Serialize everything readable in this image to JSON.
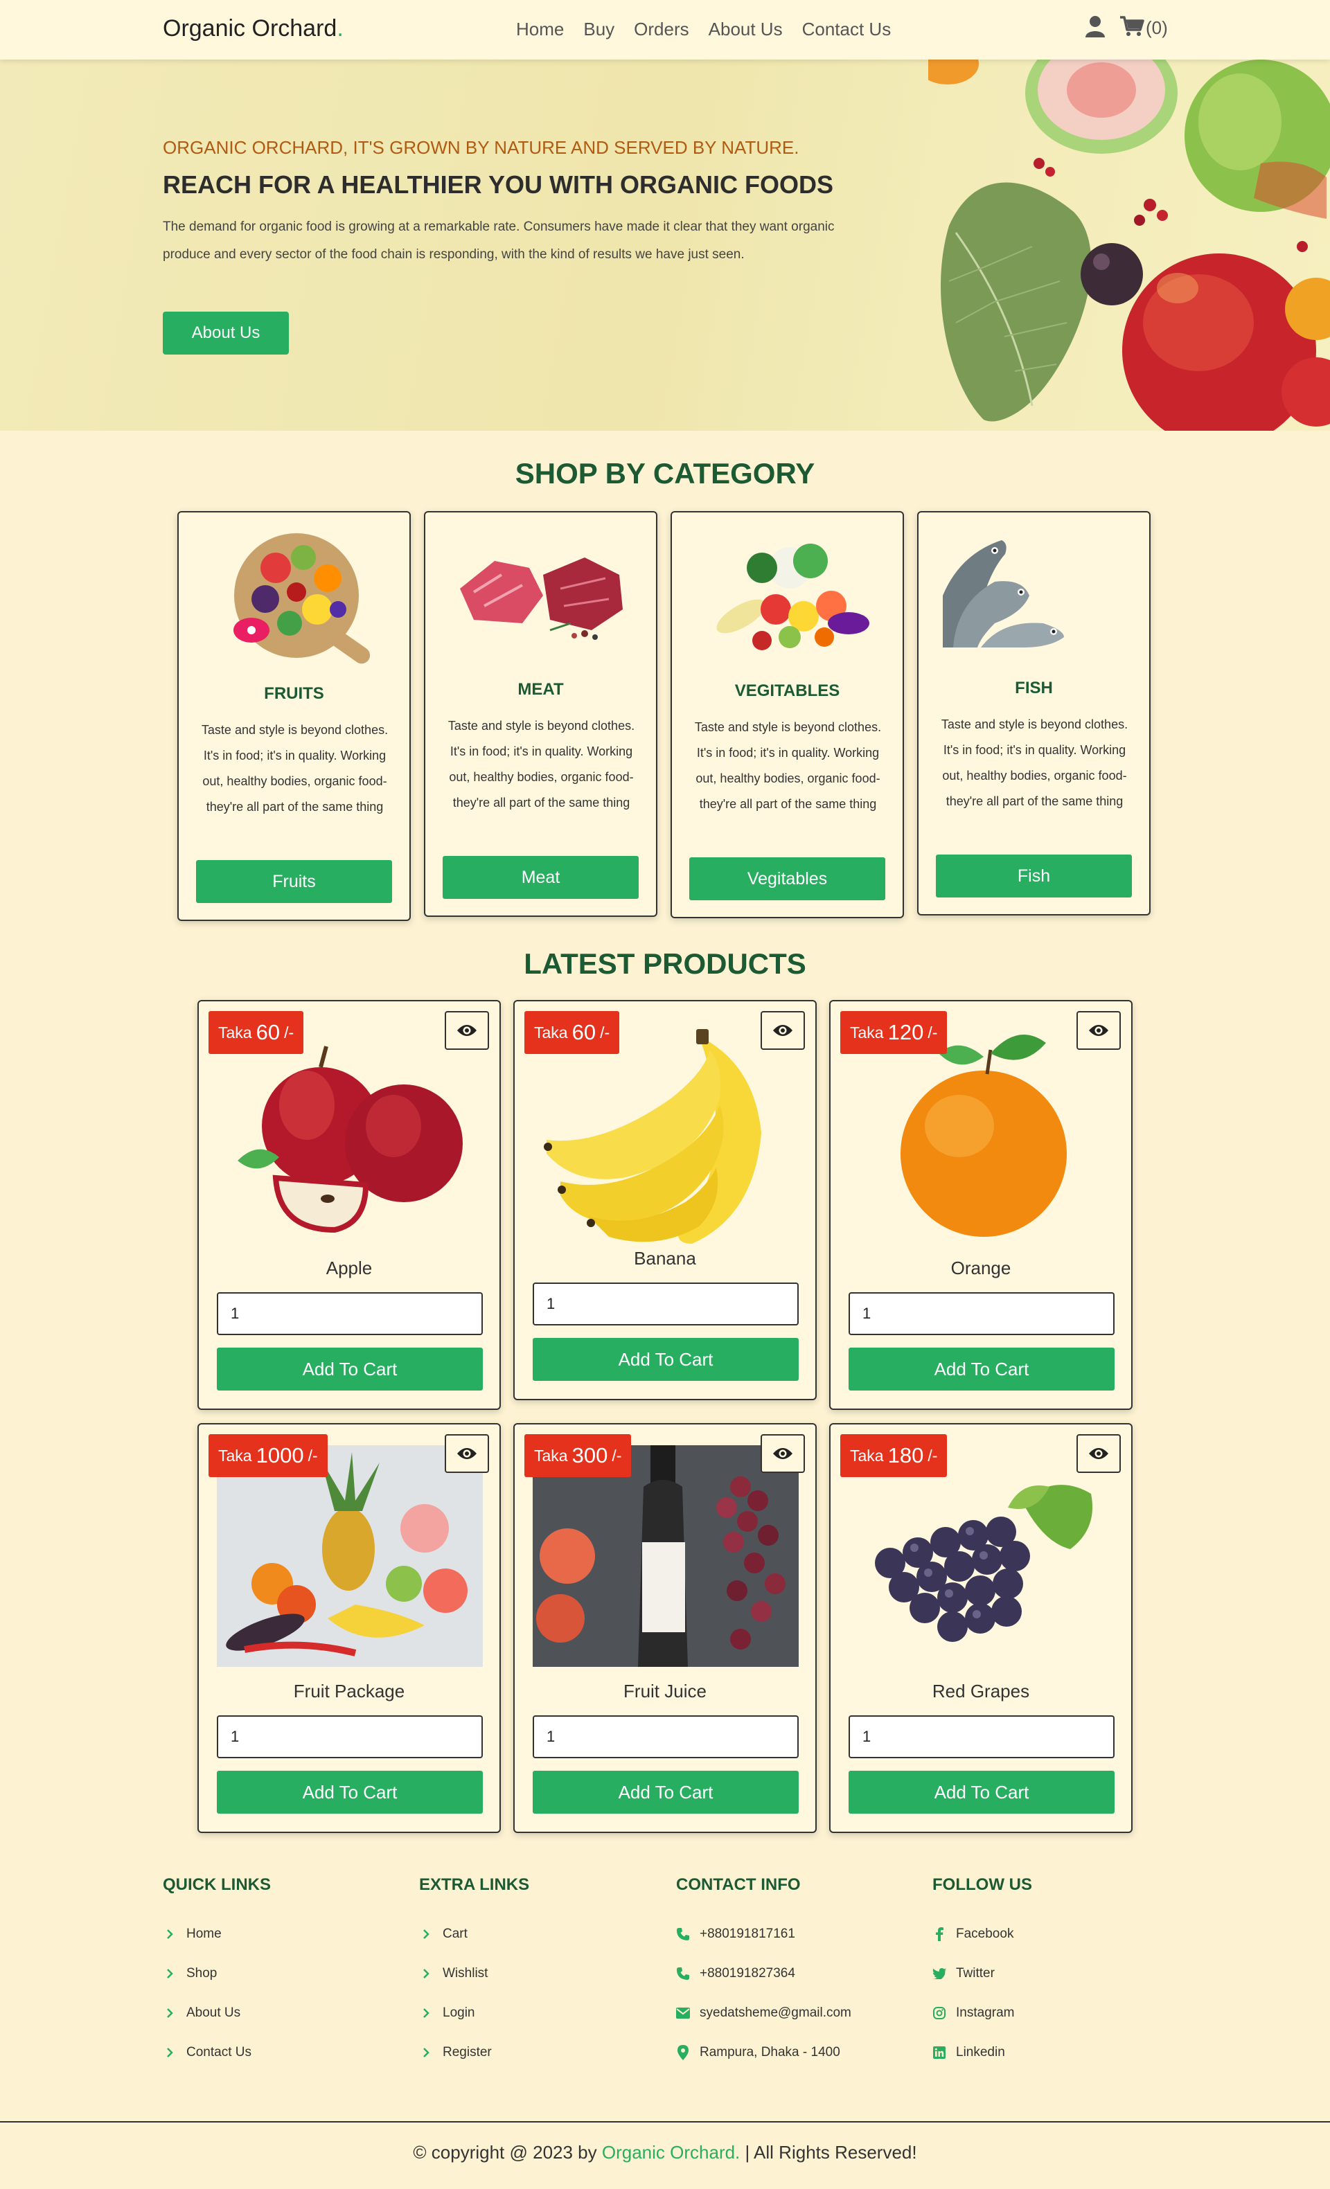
{
  "header": {
    "logo": "Organic Orchard",
    "logo_dot": ".",
    "nav": [
      "Home",
      "Buy",
      "Orders",
      "About Us",
      "Contact Us"
    ],
    "cart_count": "(0)"
  },
  "hero": {
    "tagline": "ORGANIC ORCHARD, IT'S GROWN BY NATURE AND SERVED BY NATURE.",
    "title": "REACH FOR A HEALTHIER YOU WITH ORGANIC FOODS",
    "text": "The demand for organic food is growing at a remarkable rate. Consumers have made it clear that they want organic produce and every sector of the food chain is responding, with the kind of results we have just seen.",
    "button": "About Us"
  },
  "categories": {
    "title": "SHOP BY CATEGORY",
    "items": [
      {
        "title": "FRUITS",
        "desc": "Taste and style is beyond clothes. It's in food; it's in quality. Working out, healthy bodies, organic food-they're all part of the same thing",
        "button": "Fruits"
      },
      {
        "title": "MEAT",
        "desc": "Taste and style is beyond clothes. It's in food; it's in quality. Working out, healthy bodies, organic food-they're all part of the same thing",
        "button": "Meat"
      },
      {
        "title": "VEGITABLES",
        "desc": "Taste and style is beyond clothes. It's in food; it's in quality. Working out, healthy bodies, organic food-they're all part of the same thing",
        "button": "Vegitables"
      },
      {
        "title": "FISH",
        "desc": "Taste and style is beyond clothes. It's in food; it's in quality. Working out, healthy bodies, organic food-they're all part of the same thing",
        "button": "Fish"
      }
    ]
  },
  "products": {
    "title": "LATEST PRODUCTS",
    "currency": "Taka",
    "suffix": "/-",
    "add_label": "Add To Cart",
    "items": [
      {
        "name": "Apple",
        "price": "60",
        "qty": "1"
      },
      {
        "name": "Banana",
        "price": "60",
        "qty": "1"
      },
      {
        "name": "Orange",
        "price": "120",
        "qty": "1"
      },
      {
        "name": "Fruit Package",
        "price": "1000",
        "qty": "1"
      },
      {
        "name": "Fruit Juice",
        "price": "300",
        "qty": "1"
      },
      {
        "name": "Red Grapes",
        "price": "180",
        "qty": "1"
      }
    ]
  },
  "footer": {
    "quick_links": {
      "title": "QUICK LINKS",
      "items": [
        "Home",
        "Shop",
        "About Us",
        "Contact Us"
      ]
    },
    "extra_links": {
      "title": "EXTRA LINKS",
      "items": [
        "Cart",
        "Wishlist",
        "Login",
        "Register"
      ]
    },
    "contact": {
      "title": "CONTACT INFO",
      "items": [
        "+880191817161",
        "+880191827364",
        "syedatsheme@gmail.com",
        "Rampura, Dhaka - 1400"
      ]
    },
    "follow": {
      "title": "FOLLOW US",
      "items": [
        "Facebook",
        "Twitter",
        "Instagram",
        "Linkedin"
      ]
    },
    "copyright_prefix": "© copyright @ 2023 by",
    "copyright_brand": "Organic Orchard.",
    "copyright_suffix": "| All Rights Reserved!"
  },
  "colors": {
    "accent": "#27ae60",
    "heading": "#1c5a34",
    "badge": "#e5321d",
    "page_bg": "#fdf3d3",
    "tagline": "#b15a12"
  }
}
